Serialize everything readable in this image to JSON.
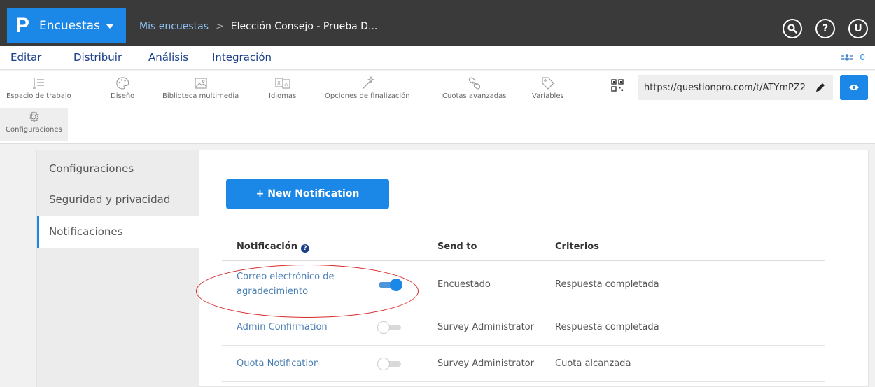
{
  "header": {
    "logo": "P",
    "product": "Encuestas",
    "breadcrumb": {
      "parent": "Mis encuestas",
      "separator": ">",
      "current": "Elección Consejo - Prueba D..."
    },
    "buttons": {
      "search": "search-icon",
      "help": "?",
      "user": "U"
    }
  },
  "menu": {
    "items": [
      "Editar",
      "Distribuir",
      "Análisis",
      "Integración"
    ],
    "active": "Editar",
    "users_count": "0"
  },
  "toolbar": {
    "tools": [
      {
        "label": "Espacio de trabajo",
        "icon": "workspace-icon"
      },
      {
        "label": "Diseño",
        "icon": "palette-icon"
      },
      {
        "label": "Biblioteca multimedia",
        "icon": "image-icon"
      },
      {
        "label": "Idiomas",
        "icon": "translate-icon"
      },
      {
        "label": "Opciones de finalización",
        "icon": "wand-icon"
      },
      {
        "label": "Cuotas avanzadas",
        "icon": "link-icon"
      },
      {
        "label": "Variables",
        "icon": "tag-icon"
      },
      {
        "label": "Configuraciones",
        "icon": "gear-icon"
      }
    ],
    "url": "https://questionpro.com/t/ATYmPZ2"
  },
  "sidebar": {
    "items": [
      "Configuraciones",
      "Seguridad y privacidad",
      "Notificaciones"
    ],
    "active": "Notificaciones"
  },
  "main": {
    "new_button": "+  New Notification",
    "table": {
      "headers": {
        "notification": "Notificación",
        "send_to": "Send to",
        "criteria": "Criterios"
      },
      "rows": [
        {
          "name_line1": "Correo electrónico de",
          "name_line2": "agradecimiento",
          "enabled": true,
          "send_to": "Encuestado",
          "criteria": "Respuesta completada"
        },
        {
          "name": "Admin Confirmation",
          "enabled": false,
          "send_to": "Survey Administrator",
          "criteria": "Respuesta completada"
        },
        {
          "name": "Quota Notification",
          "enabled": false,
          "send_to": "Survey Administrator",
          "criteria": "Cuota alcanzada"
        }
      ]
    }
  },
  "colors": {
    "brand": "#1b87e6",
    "topbar": "#3a3a3a",
    "annotation": "#d62a2a"
  }
}
